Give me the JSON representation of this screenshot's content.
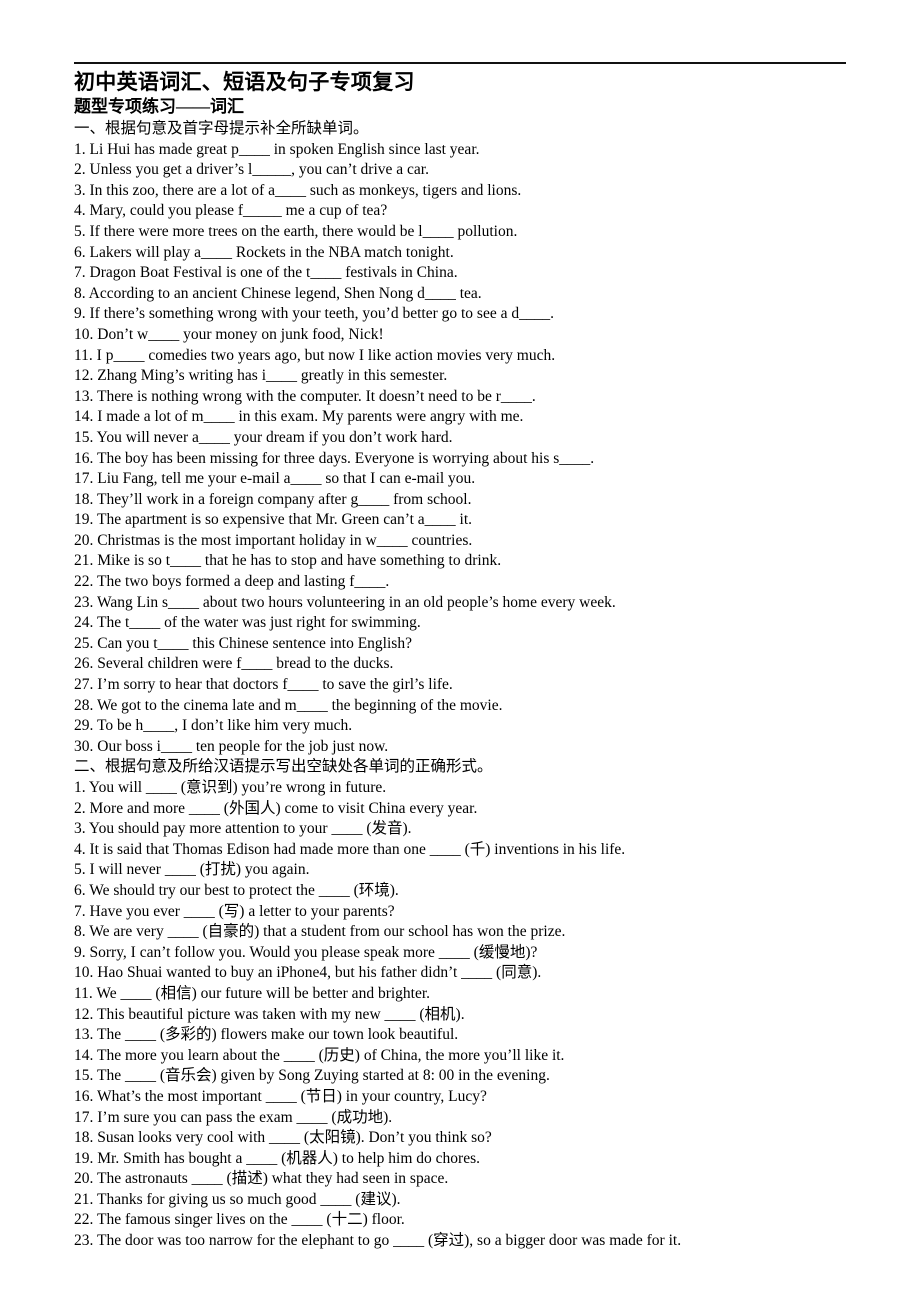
{
  "document": {
    "title": "初中英语词汇、短语及句子专项复习",
    "subtitle": "题型专项练习——词汇"
  },
  "sections": [
    {
      "heading": "一、根据句意及首字母提示补全所缺单词。",
      "items": [
        "1. Li Hui has made great p____ in spoken English since last year.",
        "2. Unless you get a driver’s l_____, you can’t drive a car.",
        "3. In this zoo, there are a lot of a____ such as monkeys, tigers and lions.",
        "4. Mary, could you please f_____ me a cup of tea?",
        "5. If there were more trees on the earth, there would be l____ pollution.",
        "6. Lakers will play a____ Rockets in the NBA match tonight.",
        "7. Dragon Boat Festival is one of the t____ festivals in China.",
        "8. According to an ancient Chinese legend, Shen Nong d____ tea.",
        "9. If there’s something wrong with your teeth, you’d better go to see a d____.",
        "10. Don’t w____ your money on junk food, Nick!",
        "11. I p____ comedies two years ago, but now I like action movies very much.",
        "12. Zhang Ming’s writing has i____ greatly in this semester.",
        "13. There is nothing wrong with the computer. It doesn’t need to be r____.",
        "14. I made a lot of m____ in this exam. My parents were angry with me.",
        "15. You will never a____ your dream if you don’t work hard.",
        "16. The boy has been missing for three days. Everyone is worrying about his s____.",
        "17. Liu Fang, tell me your e-mail a____ so that I can e-mail you.",
        "18. They’ll work in a foreign company after g____ from school.",
        "19. The apartment is so expensive that Mr. Green can’t a____ it.",
        "20. Christmas is the most important holiday in w____ countries.",
        "21. Mike is so t____ that he has to stop and have something to drink.",
        "22. The two boys formed a deep and lasting f____.",
        "23. Wang Lin s____ about two hours volunteering in an old people’s home every week.",
        "24. The t____ of the water was just right for swimming.",
        "25. Can you t____ this Chinese sentence into English?",
        "26. Several children were f____ bread to the ducks.",
        "27. I’m sorry to hear that doctors f____ to save the girl’s life.",
        "28. We got to the cinema late and m____ the beginning of the movie.",
        "29. To be h____, I don’t like him very much.",
        "30. Our boss i____ ten people for the job just now."
      ]
    },
    {
      "heading": "二、根据句意及所给汉语提示写出空缺处各单词的正确形式。",
      "items": [
        "1. You will ____ (意识到) you’re wrong in future.",
        "2. More and more ____ (外国人) come to visit China every year.",
        "3. You should pay more attention to your ____ (发音).",
        "4. It is said that Thomas Edison had made more than one ____ (千) inventions in his life.",
        "5. I will never ____ (打扰) you again.",
        "6. We should try our best to protect the ____ (环境).",
        "7. Have you ever ____ (写) a letter to your parents?",
        "8. We are very ____ (自豪的) that a student from our school has won the prize.",
        "9. Sorry, I can’t follow you. Would you please speak more ____ (缓慢地)?",
        "10. Hao Shuai wanted to buy an iPhone4, but his father didn’t ____ (同意).",
        "11. We ____ (相信) our future will be better and brighter.",
        "12. This beautiful picture was taken with my new ____ (相机).",
        "13. The ____ (多彩的) flowers make our town look beautiful.",
        "14. The more you learn about the ____ (历史) of China, the more you’ll like it.",
        "15. The ____ (音乐会) given by Song Zuying started at 8: 00 in the evening.",
        "16. What’s the most important ____ (节日) in your country, Lucy?",
        "17. I’m sure you can pass the exam ____ (成功地).",
        "18. Susan looks very cool with ____ (太阳镜). Don’t you think so?",
        "19. Mr. Smith has bought a ____ (机器人) to help him do chores.",
        "20. The astronauts ____ (描述) what they had seen in space.",
        "21. Thanks for giving us so much good ____ (建议).",
        "22. The famous singer lives on the ____ (十二) floor.",
        "23. The door was too narrow for the elephant to go ____ (穿过), so a bigger door was made for it."
      ]
    }
  ]
}
